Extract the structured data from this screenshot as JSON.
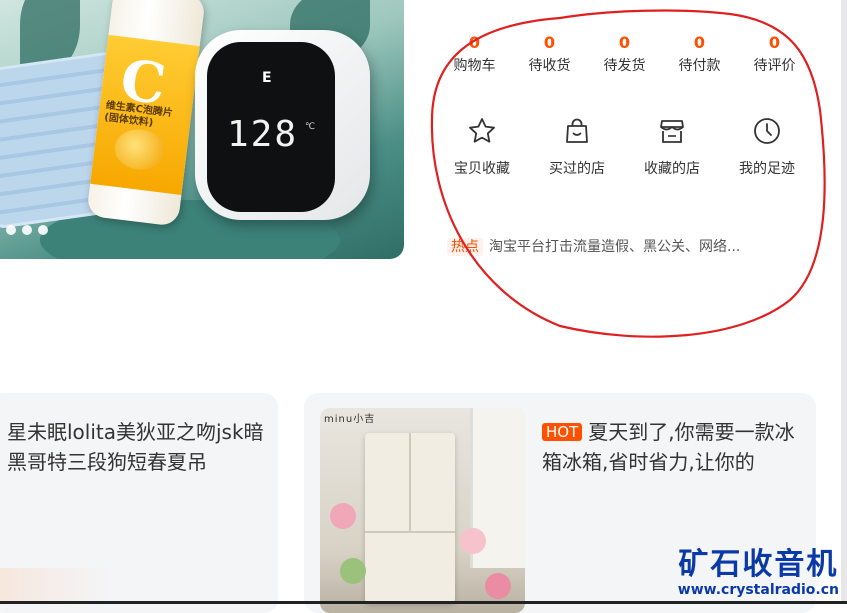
{
  "colors": {
    "accent": "#ff5000",
    "highlight_circle": "#e02020",
    "watermark": "#0a3aa8"
  },
  "banner": {
    "device_logo": "E",
    "device_reading": "128",
    "device_unit": "℃",
    "bottle_text": "维生素C泡腾片\n(固体饮料)",
    "carousel_dots": 3
  },
  "user_panel": {
    "counts": [
      {
        "value": "0",
        "label": "购物车"
      },
      {
        "value": "0",
        "label": "待收货"
      },
      {
        "value": "0",
        "label": "待发货"
      },
      {
        "value": "0",
        "label": "待付款"
      },
      {
        "value": "0",
        "label": "待评价"
      }
    ],
    "shortcuts": [
      {
        "icon": "star-icon",
        "label": "宝贝收藏"
      },
      {
        "icon": "shopping-bag-icon",
        "label": "买过的店"
      },
      {
        "icon": "store-icon",
        "label": "收藏的店"
      },
      {
        "icon": "clock-icon",
        "label": "我的足迹"
      }
    ],
    "news": {
      "tag": "热点",
      "text": "淘宝平台打击流量造假、黑公关、网络..."
    }
  },
  "cards": [
    {
      "text": "星未眠lolita美狄亚之吻jsk暗黑哥特三段狗短春夏吊"
    },
    {
      "badge": "HOT",
      "text": "夏天到了,你需要一款冰箱冰箱,省时省力,让你的",
      "image_brand": "minu小吉"
    }
  ],
  "watermark": {
    "title": "矿石收音机",
    "url": "www.crystalradio.cn"
  }
}
